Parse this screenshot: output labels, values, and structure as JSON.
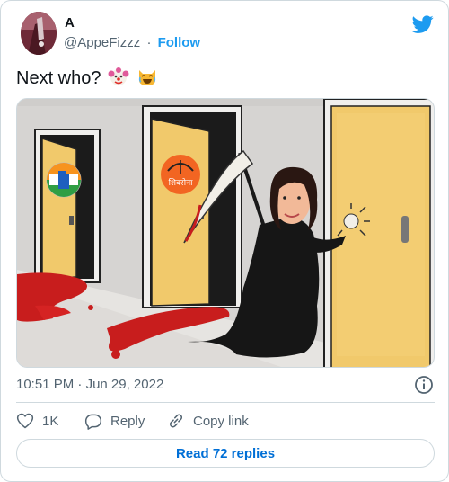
{
  "author": {
    "name": "A",
    "handle": "@AppeFizzz",
    "separator": "·",
    "follow_label": "Follow",
    "avatar_icon": "avatar-image"
  },
  "tweet": {
    "text": "Next who?",
    "emojis": [
      "clown-face",
      "laughing-cat-face"
    ]
  },
  "media": {
    "description_icon": "meme-image",
    "door_logos": [
      "congress-hand-logo",
      "shivsena-bow-arrow-logo"
    ],
    "door_logo_text": "शिवसेना"
  },
  "timestamp": {
    "time": "10:51 PM",
    "separator": "·",
    "date": "Jun 29, 2022"
  },
  "actions": {
    "like_count": "1K",
    "reply_label": "Reply",
    "copy_link_label": "Copy link"
  },
  "read_replies_label": "Read 72 replies",
  "colors": {
    "accent": "#1d9bf0",
    "link": "#006fd6",
    "text": "#0f1419",
    "muted": "#536471",
    "border": "#cfd9de"
  }
}
